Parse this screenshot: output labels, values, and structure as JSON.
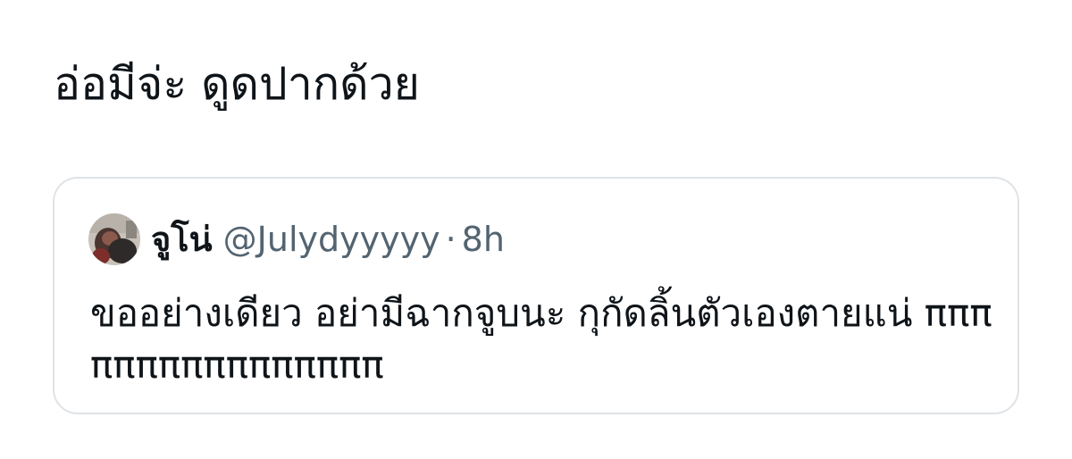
{
  "tweet": {
    "text": "อ่อมีจ่ะ ดูดปากด้วย"
  },
  "quoted_tweet": {
    "author": {
      "display_name": "จูโน่",
      "handle": "@Julydyyyyy",
      "avatar_icon": "profile-avatar"
    },
    "separator": "·",
    "time": "8h",
    "text": "ขออย่างเดียว อย่ามีฉากจูบนะ กุกัดลิ้นตัวเองตายแน่ ππππππππππππππππ"
  },
  "colors": {
    "text": "#0f1419",
    "secondary_text": "#536471",
    "card_border": "#dfe3e6",
    "background": "#ffffff"
  }
}
